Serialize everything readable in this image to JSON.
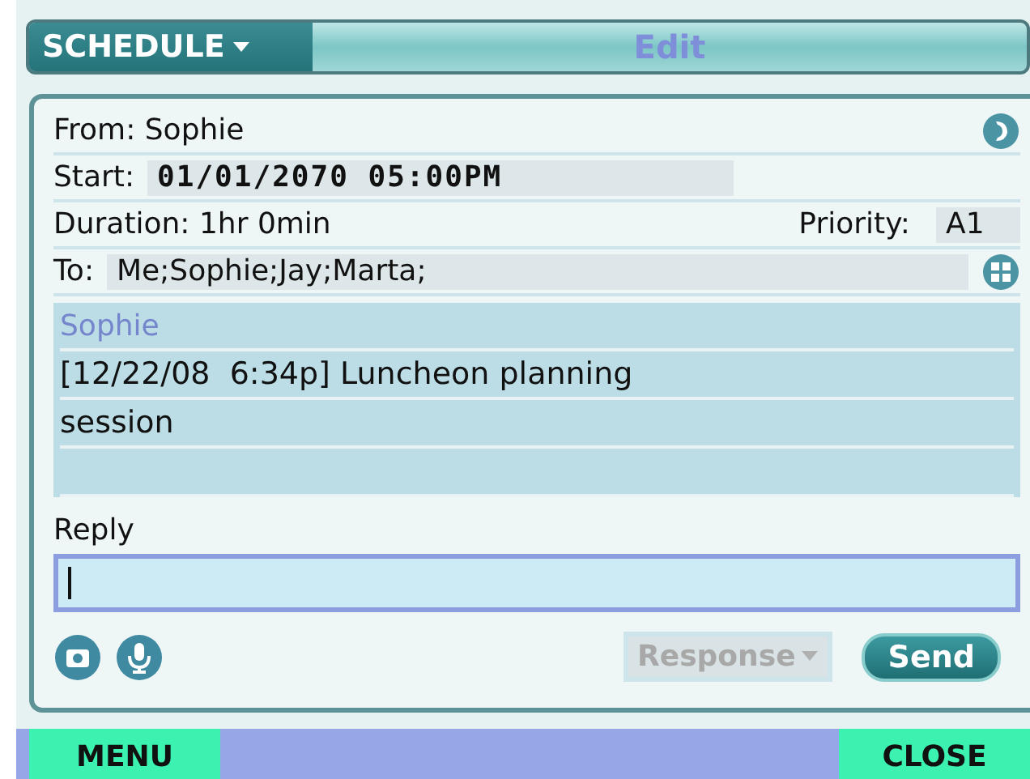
{
  "header": {
    "menu_label": "SCHEDULE",
    "title": "Edit"
  },
  "details": {
    "from": "From: Sophie",
    "start_label": "Start:",
    "start_value": "01/01/2070 05:00PM",
    "duration": "Duration: 1hr 0min",
    "priority_label": "Priority:",
    "priority_value": "A1",
    "to_label": "To:",
    "to_value": "Me;Sophie;Jay;Marta;"
  },
  "message": {
    "sender": "Sophie",
    "lines": [
      "[12/22/08  6:34p] Luncheon planning",
      "session"
    ]
  },
  "reply": {
    "label": "Reply"
  },
  "response": {
    "label": "Response",
    "disabled": true
  },
  "send": {
    "label": "Send"
  },
  "softkeys": [
    {
      "label": "MENU"
    },
    {
      "label": "CLOSE"
    }
  ]
}
